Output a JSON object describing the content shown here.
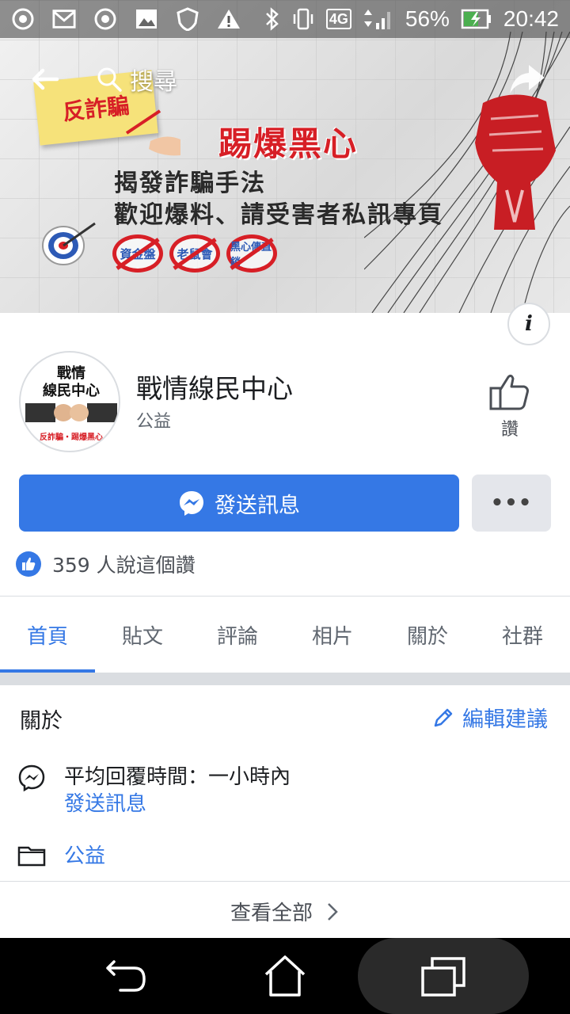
{
  "status_bar": {
    "time": "20:42",
    "battery": "56%",
    "network": "4G",
    "left_icons": [
      "chrome-icon",
      "gmail-icon",
      "chrome-icon",
      "gallery-icon",
      "shield-icon",
      "alert-icon"
    ],
    "right_icons": [
      "bluetooth-icon",
      "vibrate-icon",
      "signal-icon",
      "battery-charging-icon"
    ]
  },
  "toolbar": {
    "search_label": "搜尋"
  },
  "cover": {
    "note_text": "反詐騙",
    "headline": "踢爆黑心",
    "line1": "揭發詐騙手法",
    "line2": "歡迎爆料、請受害者私訊專頁",
    "badges": [
      "資金盤",
      "老鼠會",
      "黑心傳直銷"
    ],
    "accent": "#d71f26"
  },
  "profile": {
    "avatar_line1": "戰情",
    "avatar_line2": "線民中心",
    "avatar_footer": "反詐騙・踢爆黑心",
    "name": "戰情線民中心",
    "category": "公益",
    "like_label": "讚"
  },
  "actions": {
    "send_message": "發送訊息",
    "more": "•••"
  },
  "likes": {
    "text": "359 人說這個讚"
  },
  "tabs": [
    {
      "label": "首頁",
      "active": true
    },
    {
      "label": "貼文",
      "active": false
    },
    {
      "label": "評論",
      "active": false
    },
    {
      "label": "相片",
      "active": false
    },
    {
      "label": "關於",
      "active": false
    },
    {
      "label": "社群",
      "active": false
    }
  ],
  "about": {
    "title": "關於",
    "edit_suggestion": "編輯建議",
    "response_time": "平均回覆時間：一小時內",
    "response_link": "發送訊息",
    "category_link": "公益",
    "see_all": "查看全部"
  },
  "colors": {
    "brand_blue": "#3578e5",
    "text_secondary": "#606770"
  }
}
